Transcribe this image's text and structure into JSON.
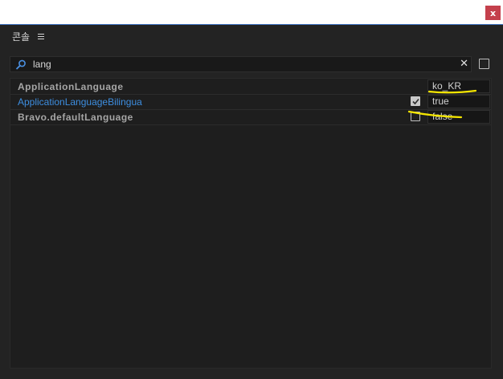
{
  "window": {
    "close_label": "x"
  },
  "panel": {
    "title": "콘솔"
  },
  "search": {
    "value": "lang",
    "clear_label": "✕"
  },
  "rows": [
    {
      "name": "ApplicationLanguage",
      "checked": null,
      "value": "ko_KR"
    },
    {
      "name": "ApplicationLanguageBilingual",
      "checked": true,
      "value": "true"
    },
    {
      "name": "Bravo.defaultLanguage",
      "checked": false,
      "value": "false"
    }
  ],
  "colors": {
    "accent_border": "#3b6fbd",
    "close_button": "#c4404c",
    "link": "#3d8ee0",
    "annotation": "#f5e600"
  },
  "icons": {
    "search": "magnifier-icon",
    "menu": "hamburger-icon",
    "clear": "close-icon"
  }
}
